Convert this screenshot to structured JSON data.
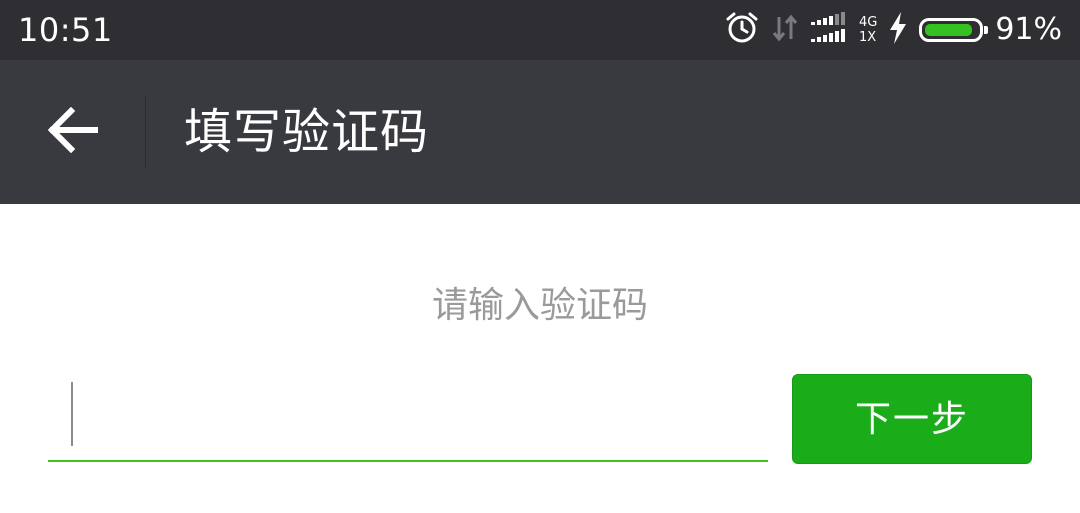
{
  "status_bar": {
    "time": "10:51",
    "network_type_top": "4G",
    "network_type_bottom": "1X",
    "battery_percent_text": "91%",
    "battery_level": 0.91,
    "icons": [
      "alarm-icon",
      "data-arrows-icon",
      "signal-icon",
      "charging-icon",
      "battery-icon"
    ]
  },
  "toolbar": {
    "title": "填写验证码",
    "back_icon": "arrow-left-icon"
  },
  "main": {
    "prompt": "请输入验证码",
    "code_input": {
      "value": "",
      "placeholder": ""
    },
    "next_button_label": "下一步"
  },
  "colors": {
    "status_bar_bg": "#2f2f33",
    "toolbar_bg": "#393a3f",
    "accent_green": "#1aad19",
    "input_underline": "#45c01a",
    "prompt_text": "#9a9a9a",
    "battery_fill": "#35c11f"
  }
}
